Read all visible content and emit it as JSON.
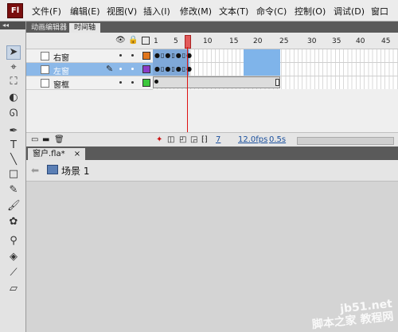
{
  "menubar": {
    "logo": "Fl",
    "items": [
      "文件(F)",
      "编辑(E)",
      "视图(V)",
      "插入(I)",
      "修改(M)",
      "文本(T)",
      "命令(C)",
      "控制(O)",
      "调试(D)",
      "窗口"
    ]
  },
  "panel_tabs": {
    "motion_editor": "动画编辑器",
    "timeline": "时间轴"
  },
  "timeline": {
    "frame_numbers": [
      "1",
      "5",
      "10",
      "15",
      "20",
      "25",
      "30",
      "35",
      "40",
      "45"
    ],
    "current_frame": "7",
    "fps": "12.0fps",
    "time": "0.5s",
    "layers": [
      {
        "name": "右窗",
        "color": "#e0761c",
        "selected": false
      },
      {
        "name": "左窗",
        "color": "#8a3cc8",
        "selected": true
      },
      {
        "name": "窗框",
        "color": "#3cc83c",
        "selected": false
      }
    ]
  },
  "document": {
    "tab_label": "窗户.fla*",
    "close": "×",
    "scene_label": "场景 1"
  },
  "watermark": {
    "line1": "jb51.net",
    "line2": "脚本之家 教程网"
  }
}
